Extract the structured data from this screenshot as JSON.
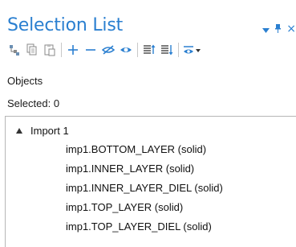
{
  "panel": {
    "title": "Selection List",
    "controls": {
      "menu_icon": "dropdown-triangle-icon",
      "pin_icon": "pin-icon",
      "close_glyph": "×"
    }
  },
  "toolbar": {
    "plus_glyph": "+",
    "minus_glyph": "—"
  },
  "objects_label": "Objects",
  "selected_label": "Selected: 0",
  "tree": {
    "root_label": "Import 1",
    "items": [
      "imp1.BOTTOM_LAYER (solid)",
      "imp1.INNER_LAYER (solid)",
      "imp1.INNER_LAYER_DIEL (solid)",
      "imp1.TOP_LAYER (solid)",
      "imp1.TOP_LAYER_DIEL (solid)"
    ]
  },
  "colors": {
    "accent": "#2a7fd0",
    "icon_gray": "#7a7a7a"
  }
}
